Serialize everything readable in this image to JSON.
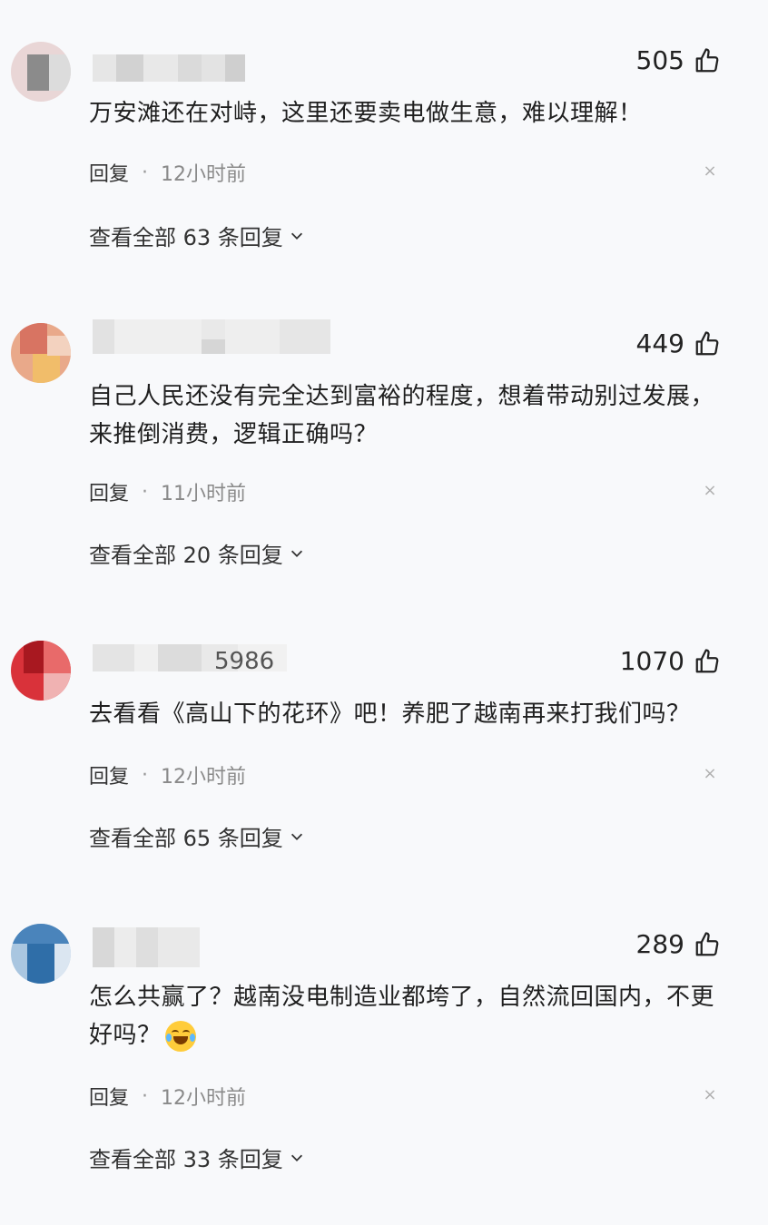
{
  "comments": [
    {
      "likes": "505",
      "text": "万安滩还在对峙，这里还要卖电做生意，难以理解！",
      "reply_label": "回复",
      "time": "12小时前",
      "view_all": "查看全部 63 条回复",
      "avatar_colors": [
        "#e9d6d6",
        "#8b8b8b",
        "#d9d9d9",
        "#bdbdbd"
      ]
    },
    {
      "likes": "449",
      "text": "自己人民还没有完全达到富裕的程度，想着带动别过发展，来推倒消费，逻辑正确吗？",
      "reply_label": "回复",
      "time": "11小时前",
      "view_all": "查看全部 20 条回复",
      "avatar_colors": [
        "#e7b28a",
        "#d46a5a",
        "#f0c9a8",
        "#e5a070"
      ]
    },
    {
      "likes": "1070",
      "name_fragment": "5986",
      "text": "去看看《高山下的花环》吧！养肥了越南再来打我们吗？",
      "reply_label": "回复",
      "time": "12小时前",
      "view_all": "查看全部 65 条回复",
      "avatar_colors": [
        "#d9323a",
        "#a81820",
        "#e86a6a",
        "#c42a30"
      ]
    },
    {
      "likes": "289",
      "text": "怎么共赢了？越南没电制造业都垮了，自然流回国内，不更好吗？",
      "emoji": "laughing-crying-emoji",
      "reply_label": "回复",
      "time": "12小时前",
      "view_all": "查看全部 33 条回复",
      "avatar_colors": [
        "#6a9ccc",
        "#2f6ea8",
        "#a9c6e0",
        "#4a84bb"
      ]
    }
  ]
}
